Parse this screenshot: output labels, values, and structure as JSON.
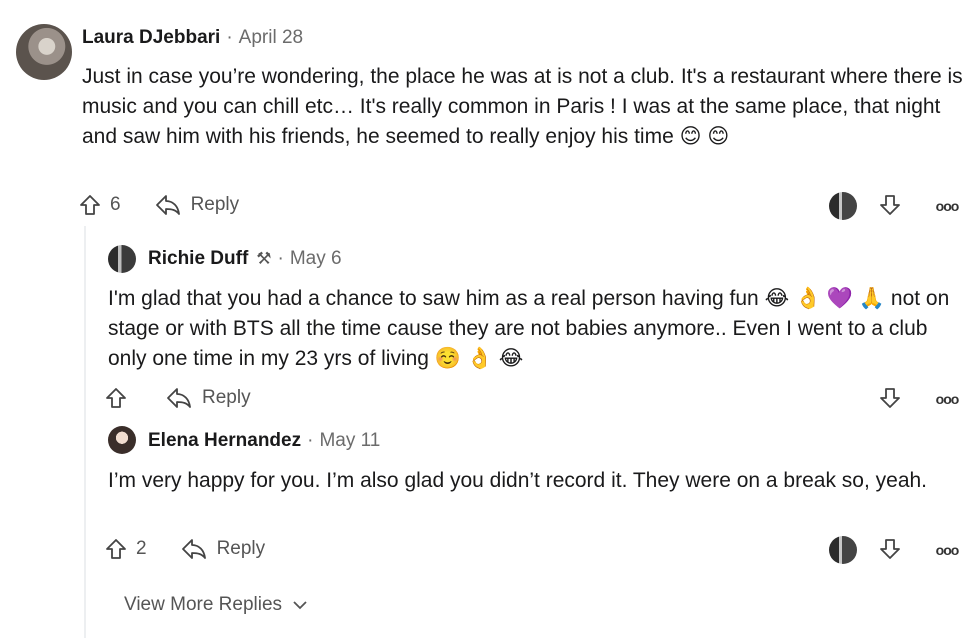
{
  "comments": [
    {
      "author": "Laura DJebbari",
      "date": "April 28",
      "text": "Just in case you’re wondering, the place he was at is not a club. It's a restaurant where there is music and you can chill etc… It's really common in Paris ! I was at the same place, that night and saw him with his friends, he seemed to really enjoy his time 😊 😊",
      "votes": "6",
      "reply_label": "Reply"
    },
    {
      "author": "Richie Duff",
      "date": "May 6",
      "text": "I'm glad that you had a chance to saw him as a real person having fun 😂 👌 💜 🙏 not on stage or with BTS all the time cause they are not babies anymore.. Even I went to a club only one time in my 23 yrs of living ☺️ 👌 😂",
      "votes": "",
      "reply_label": "Reply"
    },
    {
      "author": "Elena Hernandez",
      "date": "May 11",
      "text": "I’m very happy for you. I’m also glad you didn’t record it. They were on a break so, yeah.",
      "votes": "2",
      "reply_label": "Reply"
    }
  ],
  "separator": "·",
  "view_more_label": "View More Replies",
  "icons": {
    "upvote": "arrow-up-icon",
    "downvote": "arrow-down-icon",
    "reply": "reply-arrow-icon",
    "more": "more-options-icon",
    "moderator": "hammer-icon"
  },
  "colors": {
    "text": "#1a1a1b",
    "muted": "#6b6b6b",
    "thread_line": "#edeff1"
  }
}
